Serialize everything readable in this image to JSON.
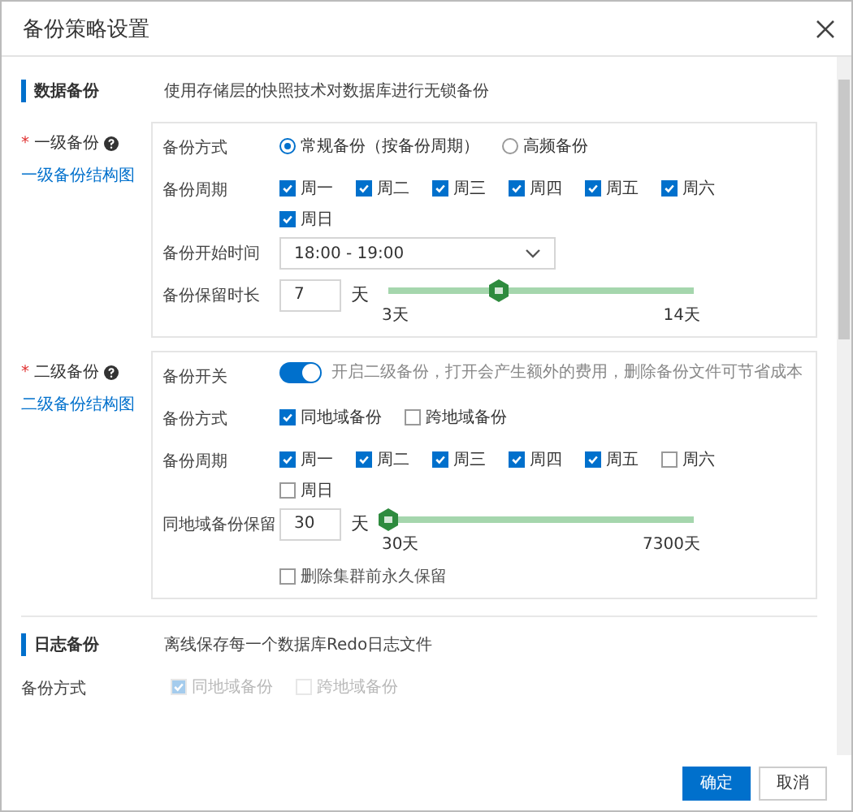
{
  "dialog": {
    "title": "备份策略设置"
  },
  "data_backup": {
    "title": "数据备份",
    "description": "使用存储层的快照技术对数据库进行无锁备份",
    "tiers": [
      {
        "label": "一级备份",
        "required_mark": "*",
        "link": "一级备份结构图",
        "fields": [
          {
            "kind": "radio",
            "label": "备份方式",
            "options": [
              {
                "label": "常规备份（按备份周期）",
                "selected": true
              },
              {
                "label": "高频备份",
                "selected": false
              }
            ]
          },
          {
            "kind": "checkboxes",
            "label": "备份周期",
            "disabled": false,
            "options": [
              {
                "label": "周一",
                "checked": true
              },
              {
                "label": "周二",
                "checked": true
              },
              {
                "label": "周三",
                "checked": true
              },
              {
                "label": "周四",
                "checked": true
              },
              {
                "label": "周五",
                "checked": true
              },
              {
                "label": "周六",
                "checked": true
              },
              {
                "label": "周日",
                "checked": true
              }
            ]
          },
          {
            "kind": "select",
            "label": "备份开始时间",
            "value": "18:00 - 19:00"
          },
          {
            "kind": "slider",
            "label": "备份保留时长",
            "value": "7",
            "unit": "天",
            "level": 0.36,
            "min_label": "3天",
            "max_label": "14天"
          }
        ]
      },
      {
        "label": "二级备份",
        "required_mark": "*",
        "link": "二级备份结构图",
        "fields": [
          {
            "kind": "switch",
            "label": "备份开关",
            "on": true,
            "hint": "开启二级备份，打开会产生额外的费用，删除备份文件可节省成本"
          },
          {
            "kind": "checkboxes",
            "label": "备份方式",
            "disabled": false,
            "options": [
              {
                "label": "同地域备份",
                "checked": true
              },
              {
                "label": "跨地域备份",
                "checked": false
              }
            ]
          },
          {
            "kind": "checkboxes",
            "label": "备份周期",
            "disabled": false,
            "options": [
              {
                "label": "周一",
                "checked": true
              },
              {
                "label": "周二",
                "checked": true
              },
              {
                "label": "周三",
                "checked": true
              },
              {
                "label": "周四",
                "checked": true
              },
              {
                "label": "周五",
                "checked": true
              },
              {
                "label": "周六",
                "checked": false
              },
              {
                "label": "周日",
                "checked": false
              }
            ]
          },
          {
            "kind": "slider",
            "label": "同地域备份保留",
            "value": "30",
            "unit": "天",
            "level": 0,
            "min_label": "30天",
            "max_label": "7300天",
            "option": {
              "label": "删除集群前永久保留",
              "checked": false
            }
          }
        ]
      }
    ]
  },
  "log_backup": {
    "title": "日志备份",
    "description": "离线保存每一个数据库Redo日志文件",
    "fields": [
      {
        "kind": "checkboxes",
        "label": "备份方式",
        "disabled": true,
        "options": [
          {
            "label": "同地域备份",
            "checked": true
          },
          {
            "label": "跨地域备份",
            "checked": false
          }
        ]
      }
    ]
  },
  "buttons": [
    {
      "label": "确定",
      "primary": true
    },
    {
      "label": "取消",
      "primary": false
    }
  ]
}
